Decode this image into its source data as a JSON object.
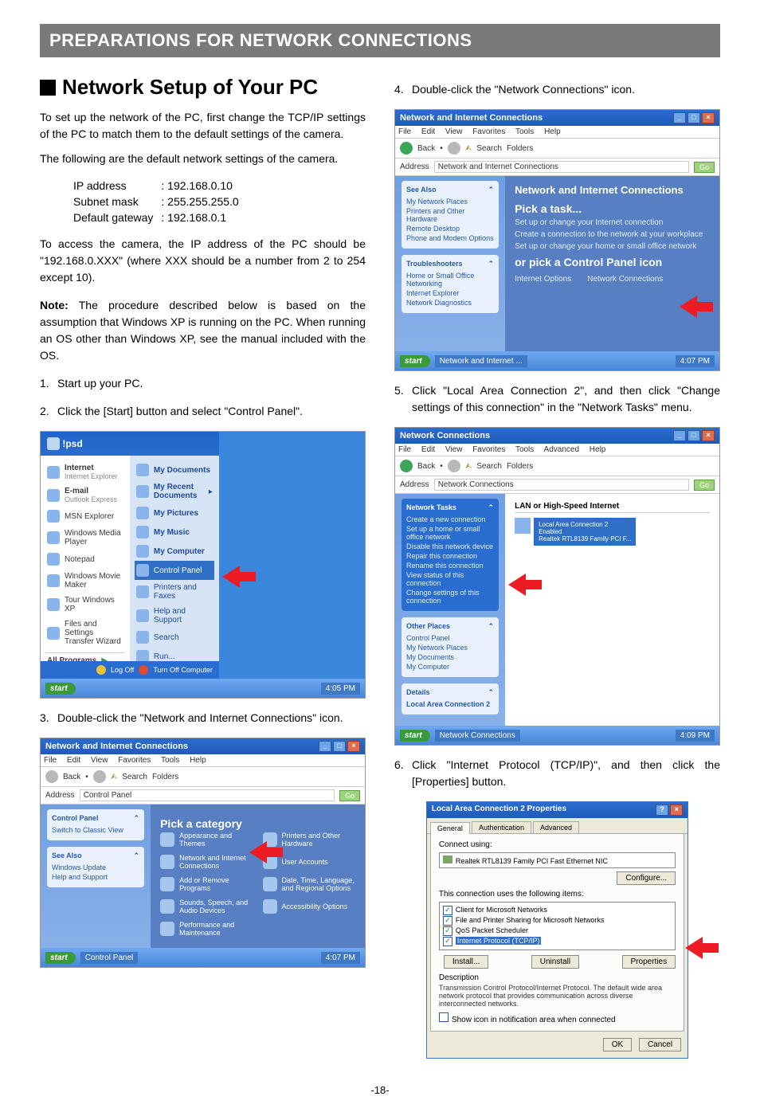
{
  "banner": "PREPARATIONS FOR NETWORK CONNECTIONS",
  "heading": "Network Setup of Your PC",
  "intro": "To set up the network of the PC, first change the TCP/IP settings of the PC to match them to the default settings of the camera.",
  "intro2": "The following are the default network settings of the camera.",
  "net": {
    "ip_lbl": "IP address",
    "ip_val": ": 192.168.0.10",
    "sm_lbl": "Subnet mask",
    "sm_val": ": 255.255.255.0",
    "gw_lbl": "Default gateway",
    "gw_val": ": 192.168.0.1"
  },
  "access_para": "To access the camera, the IP address of the PC should be \"192.168.0.XXX\" (where XXX should be a number from 2 to 254 except 10).",
  "note_label": "Note:",
  "note_body": "The procedure described below is based on the assumption that Windows XP is running on the PC. When running an OS other than Windows XP, see the manual included with the OS.",
  "steps_left": {
    "s1": "Start up your PC.",
    "s2": "Click the [Start] button and select \"Control Panel\".",
    "s3": "Double-click the \"Network and Internet Connections\" icon."
  },
  "steps_right": {
    "s4": "Double-click the \"Network Connections\" icon.",
    "s5": "Click \"Local Area Connection 2\", and then click \"Change settings of this connection\" in the \"Network Tasks\" menu.",
    "s6": "Click \"Internet Protocol (TCP/IP)\", and then click the [Properties] button."
  },
  "start_menu": {
    "user": "!psd",
    "left": [
      "Internet",
      "Internet Explorer",
      "E-mail",
      "Outlook Express",
      "MSN Explorer",
      "Windows Media Player",
      "Notepad",
      "Windows Movie Maker",
      "Tour Windows XP",
      "Files and Settings Transfer Wizard",
      "All Programs"
    ],
    "right": [
      "My Documents",
      "My Recent Documents",
      "My Pictures",
      "My Music",
      "My Computer",
      "Control Panel",
      "Printers and Faxes",
      "Help and Support",
      "Search",
      "Run..."
    ],
    "hl": "Control Panel",
    "logoff": "Log Off",
    "shutdown": "Turn Off Computer",
    "start": "start",
    "tray_time": "4:05 PM"
  },
  "cp_window": {
    "title": "Network and Internet Connections",
    "menu": [
      "File",
      "Edit",
      "View",
      "Favorites",
      "Tools",
      "Help"
    ],
    "tb_back": "Back",
    "tb_search": "Search",
    "tb_folders": "Folders",
    "addr_lbl": "Address",
    "addr_val": "Control Panel",
    "go": "Go",
    "side1_title": "Control Panel",
    "side1_items": [
      "Switch to Classic View"
    ],
    "side2_title": "See Also",
    "side2_items": [
      "Windows Update",
      "Help and Support"
    ],
    "content_title": "Pick a category",
    "cats": [
      "Appearance and Themes",
      "Printers and Other Hardware",
      "Network and Internet Connections",
      "User Accounts",
      "Add or Remove Programs",
      "Date, Time, Language, and Regional Options",
      "Sounds, Speech, and Audio Devices",
      "Accessibility Options",
      "Performance and Maintenance"
    ]
  },
  "nic_window": {
    "title": "Network and Internet Connections",
    "addr_val": "Network and Internet Connections",
    "side1_title": "See Also",
    "side1_items": [
      "My Network Places",
      "Printers and Other Hardware",
      "Remote Desktop",
      "Phone and Modem Options"
    ],
    "side2_title": "Troubleshooters",
    "side2_items": [
      "Home or Small Office Networking",
      "Internet Explorer",
      "Network Diagnostics"
    ],
    "content_title": "Network and Internet Connections",
    "pick_task": "Pick a task...",
    "tasks": [
      "Set up or change your Internet connection",
      "Create a connection to the network at your workplace",
      "Set up or change your home or small office network"
    ],
    "or_pick": "or pick a Control Panel icon",
    "icons": [
      "Internet Options",
      "Network Connections"
    ],
    "taskbar_app": "Network and Internet ...",
    "tray_time": "4:07 PM"
  },
  "nc_window": {
    "title": "Network Connections",
    "menu": [
      "File",
      "Edit",
      "View",
      "Favorites",
      "Tools",
      "Advanced",
      "Help"
    ],
    "addr_val": "Network Connections",
    "side1_title": "Network Tasks",
    "side1_items": [
      "Create a new connection",
      "Set up a home or small office network",
      "Disable this network device",
      "Repair this connection",
      "Rename this connection",
      "View status of this connection",
      "Change settings of this connection"
    ],
    "side2_title": "Other Places",
    "side2_items": [
      "Control Panel",
      "My Network Places",
      "My Documents",
      "My Computer"
    ],
    "side3_title": "Details",
    "side3_item": "Local Area Connection 2",
    "section": "LAN or High-Speed Internet",
    "conn_name": "Local Area Connection 2",
    "conn_status": "Enabled",
    "conn_device": "Realtek RTL8139 Family PCI F...",
    "taskbar_app": "Network Connections",
    "tray_time": "4:09 PM"
  },
  "dlg": {
    "title": "Local Area Connection 2 Properties",
    "tabs": [
      "General",
      "Authentication",
      "Advanced"
    ],
    "connect_using": "Connect using:",
    "nic": "Realtek RTL8139 Family PCI Fast Ethernet NIC",
    "configure": "Configure...",
    "uses_label": "This connection uses the following items:",
    "items": [
      "Client for Microsoft Networks",
      "File and Printer Sharing for Microsoft Networks",
      "QoS Packet Scheduler",
      "Internet Protocol (TCP/IP)"
    ],
    "btn_install": "Install...",
    "btn_uninstall": "Uninstall",
    "btn_props": "Properties",
    "desc_label": "Description",
    "desc_text": "Transmission Control Protocol/Internet Protocol. The default wide area network protocol that provides communication across diverse interconnected networks.",
    "show_icon": "Show icon in notification area when connected",
    "ok": "OK",
    "cancel": "Cancel"
  },
  "pagenum": "-18-"
}
